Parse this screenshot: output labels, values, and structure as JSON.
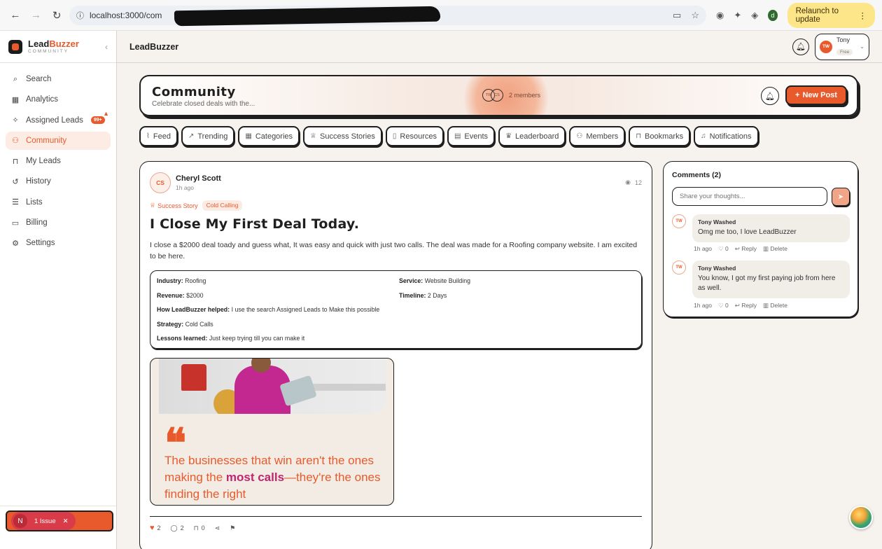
{
  "browser": {
    "url": "localhost:3000/com",
    "relaunch_label": "Relaunch to update",
    "profile_initial": "d"
  },
  "sidebar": {
    "brand_name_1": "Lead",
    "brand_name_2": "Buzzer",
    "brand_sub": "COMMUNITY",
    "items": [
      {
        "label": "Search",
        "icon": "search-icon"
      },
      {
        "label": "Analytics",
        "icon": "grid-icon"
      },
      {
        "label": "Assigned Leads",
        "icon": "sparkle-icon",
        "badge": "99+"
      },
      {
        "label": "Community",
        "icon": "users-icon",
        "active": true
      },
      {
        "label": "My Leads",
        "icon": "bookmark-icon"
      },
      {
        "label": "History",
        "icon": "history-icon"
      },
      {
        "label": "Lists",
        "icon": "list-icon"
      },
      {
        "label": "Billing",
        "icon": "card-icon"
      },
      {
        "label": "Settings",
        "icon": "gear-icon"
      }
    ],
    "issue_initial": "N",
    "issue_label": "1 Issue"
  },
  "topbar": {
    "title": "LeadBuzzer",
    "user_initials": "TW",
    "user_name": "Tony",
    "user_plan": "Free"
  },
  "banner": {
    "title": "Community",
    "subtitle": "Celebrate closed deals with the...",
    "avatar_1": "TW",
    "avatar_2": "CS",
    "members_label": "2 members",
    "new_post_label": "New Post"
  },
  "tabs": [
    {
      "label": "Feed",
      "icon": "rss-icon"
    },
    {
      "label": "Trending",
      "icon": "trending-icon"
    },
    {
      "label": "Categories",
      "icon": "categories-icon"
    },
    {
      "label": "Success Stories",
      "icon": "trophy-icon"
    },
    {
      "label": "Resources",
      "icon": "book-icon"
    },
    {
      "label": "Events",
      "icon": "calendar-icon"
    },
    {
      "label": "Leaderboard",
      "icon": "crown-icon"
    },
    {
      "label": "Members",
      "icon": "members-icon"
    },
    {
      "label": "Bookmarks",
      "icon": "bookmark-icon"
    },
    {
      "label": "Notifications",
      "icon": "bell-icon"
    }
  ],
  "post": {
    "author_initials": "CS",
    "author_name": "Cheryl Scott",
    "time": "1h ago",
    "views": "12",
    "tag_success": "Success Story",
    "tag_category": "Cold Calling",
    "title": "I Close My First Deal Today.",
    "body": "I close a $2000 deal toady and guess what, It was easy and quick with just two calls. The deal was made for a Roofing company website. I am excited to be here.",
    "details": {
      "industry_label": "Industry:",
      "industry": "Roofing",
      "service_label": "Service:",
      "service": "Website Building",
      "revenue_label": "Revenue:",
      "revenue": "$2000",
      "timeline_label": "Timeline:",
      "timeline": "2 Days",
      "helped_label": "How LeadBuzzer helped:",
      "helped": "I use the search Assigned Leads to Make this possible",
      "strategy_label": "Strategy:",
      "strategy": "Cold Calls",
      "lessons_label": "Lessons learned:",
      "lessons": "Just keep trying till you can make it"
    },
    "quote_1": "The businesses that win aren't the ones making the ",
    "quote_hl": "most calls",
    "quote_2": "—they're the ones finding the right",
    "likes": "2",
    "comments": "2",
    "bookmarks": "0"
  },
  "comments": {
    "title": "Comments (2)",
    "placeholder": "Share your thoughts...",
    "items": [
      {
        "initials": "TW",
        "author": "Tony Washed",
        "text": "Omg me too, I love LeadBuzzer",
        "time": "1h ago",
        "likes": "0",
        "reply": "Reply",
        "delete": "Delete"
      },
      {
        "initials": "TW",
        "author": "Tony Washed",
        "text": "You know, I got my first paying job from here as well.",
        "time": "1h ago",
        "likes": "0",
        "reply": "Reply",
        "delete": "Delete"
      }
    ]
  }
}
